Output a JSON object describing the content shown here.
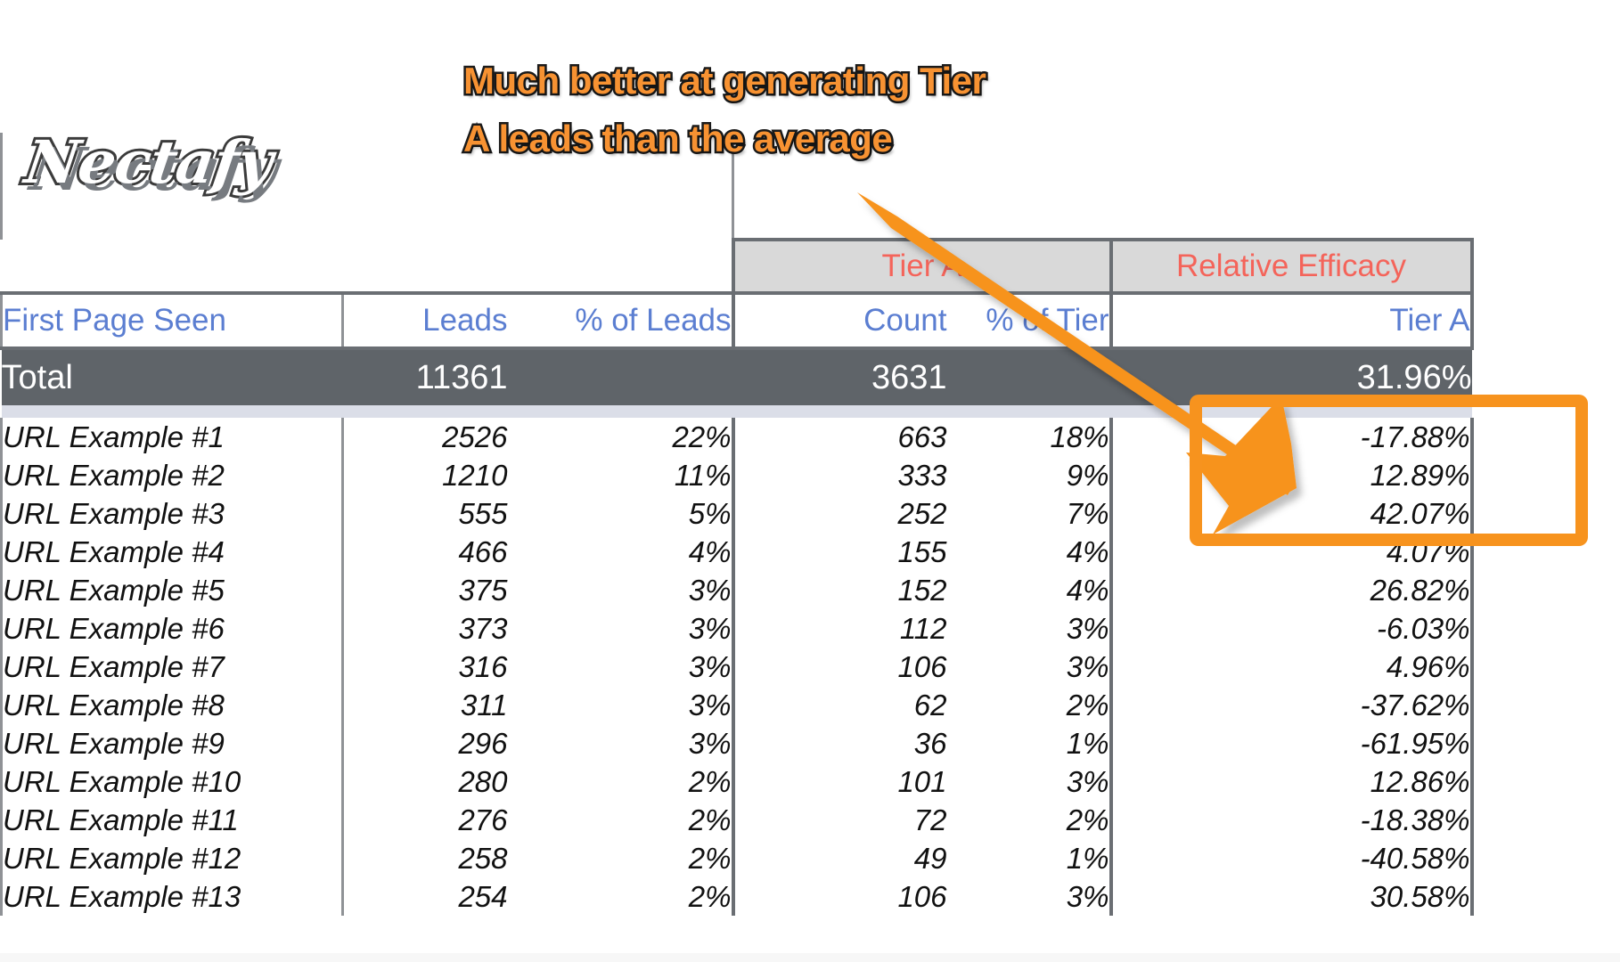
{
  "brand": {
    "logo_text": "Nectafy"
  },
  "annotation": {
    "callout_text": "Much better at generating Tier\nA leads than the average",
    "callout_color": "#f79232",
    "arrow_color": "#f7931e",
    "highlight_color": "#f7931e"
  },
  "table": {
    "group_headers": {
      "blank": "",
      "tier": "Tier A",
      "relative": "Relative Efficacy"
    },
    "columns": [
      {
        "key": "url",
        "label": "First Page Seen"
      },
      {
        "key": "leads",
        "label": "Leads"
      },
      {
        "key": "pct_leads",
        "label": "% of Leads"
      },
      {
        "key": "count",
        "label": "Count"
      },
      {
        "key": "pct_tier",
        "label": "% of Tier"
      },
      {
        "key": "efficacy",
        "label": "Tier A"
      }
    ],
    "total": {
      "label": "Total",
      "leads": "11361",
      "pct_leads": "",
      "count": "3631",
      "pct_tier": "",
      "efficacy": "31.96%"
    },
    "rows": [
      {
        "url": "URL Example #1",
        "leads": "2526",
        "pct_leads": "22%",
        "count": "663",
        "pct_tier": "18%",
        "efficacy": "-17.88%",
        "efficacy_sign": "neg"
      },
      {
        "url": "URL Example #2",
        "leads": "1210",
        "pct_leads": "11%",
        "count": "333",
        "pct_tier": "9%",
        "efficacy": "12.89%",
        "efficacy_sign": "neg"
      },
      {
        "url": "URL Example #3",
        "leads": "555",
        "pct_leads": "5%",
        "count": "252",
        "pct_tier": "7%",
        "efficacy": "42.07%",
        "efficacy_sign": "pos"
      },
      {
        "url": "URL Example #4",
        "leads": "466",
        "pct_leads": "4%",
        "count": "155",
        "pct_tier": "4%",
        "efficacy": "4.07%",
        "efficacy_sign": "pos"
      },
      {
        "url": "URL Example #5",
        "leads": "375",
        "pct_leads": "3%",
        "count": "152",
        "pct_tier": "4%",
        "efficacy": "26.82%",
        "efficacy_sign": "pos"
      },
      {
        "url": "URL Example #6",
        "leads": "373",
        "pct_leads": "3%",
        "count": "112",
        "pct_tier": "3%",
        "efficacy": "-6.03%",
        "efficacy_sign": "neg"
      },
      {
        "url": "URL Example #7",
        "leads": "316",
        "pct_leads": "3%",
        "count": "106",
        "pct_tier": "3%",
        "efficacy": "4.96%",
        "efficacy_sign": "pos"
      },
      {
        "url": "URL Example #8",
        "leads": "311",
        "pct_leads": "3%",
        "count": "62",
        "pct_tier": "2%",
        "efficacy": "-37.62%",
        "efficacy_sign": "neg"
      },
      {
        "url": "URL Example #9",
        "leads": "296",
        "pct_leads": "3%",
        "count": "36",
        "pct_tier": "1%",
        "efficacy": "-61.95%",
        "efficacy_sign": "neg"
      },
      {
        "url": "URL Example #10",
        "leads": "280",
        "pct_leads": "2%",
        "count": "101",
        "pct_tier": "3%",
        "efficacy": "12.86%",
        "efficacy_sign": "pos"
      },
      {
        "url": "URL Example #11",
        "leads": "276",
        "pct_leads": "2%",
        "count": "72",
        "pct_tier": "2%",
        "efficacy": "-18.38%",
        "efficacy_sign": "neg"
      },
      {
        "url": "URL Example #12",
        "leads": "258",
        "pct_leads": "2%",
        "count": "49",
        "pct_tier": "1%",
        "efficacy": "-40.58%",
        "efficacy_sign": "neg"
      },
      {
        "url": "URL Example #13",
        "leads": "254",
        "pct_leads": "2%",
        "count": "106",
        "pct_tier": "3%",
        "efficacy": "30.58%",
        "efficacy_sign": "pos"
      }
    ]
  }
}
